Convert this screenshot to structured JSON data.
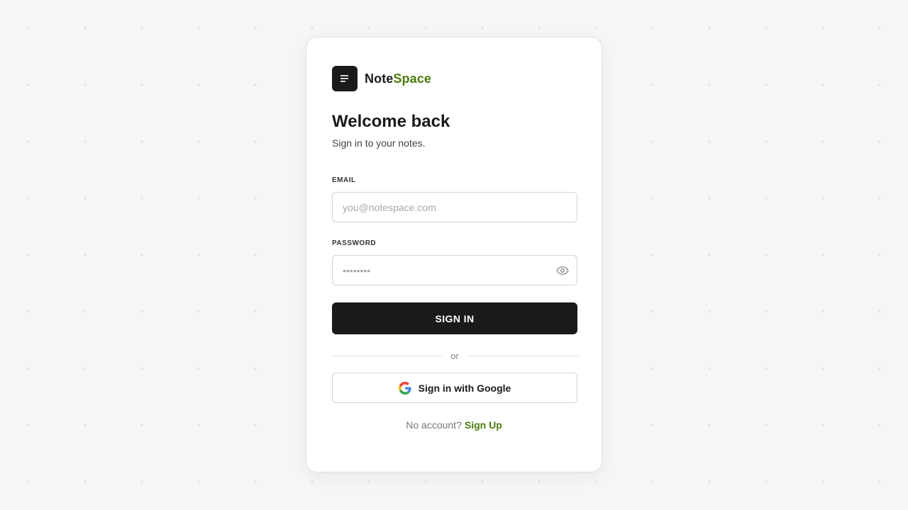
{
  "brand": {
    "name_part1": "Note",
    "name_part2": "Space",
    "logo_icon": "note-lines-icon"
  },
  "header": {
    "title": "Welcome back",
    "subtitle": "Sign in to your notes."
  },
  "form": {
    "email": {
      "label": "EMAIL",
      "placeholder": "you@notespace.com",
      "value": ""
    },
    "password": {
      "label": "PASSWORD",
      "placeholder": "••••••••",
      "value": "",
      "toggle_icon": "eye-icon"
    },
    "submit_label": "SIGN IN"
  },
  "divider": {
    "text": "or"
  },
  "oauth": {
    "google_label": "Sign in with Google",
    "icon": "google-icon"
  },
  "footer": {
    "prompt": "No account?",
    "link_label": "Sign Up"
  },
  "colors": {
    "accent": "#4a7d0a",
    "primary": "#1a1a1a",
    "background": "#f6f6f6",
    "card": "#ffffff"
  }
}
